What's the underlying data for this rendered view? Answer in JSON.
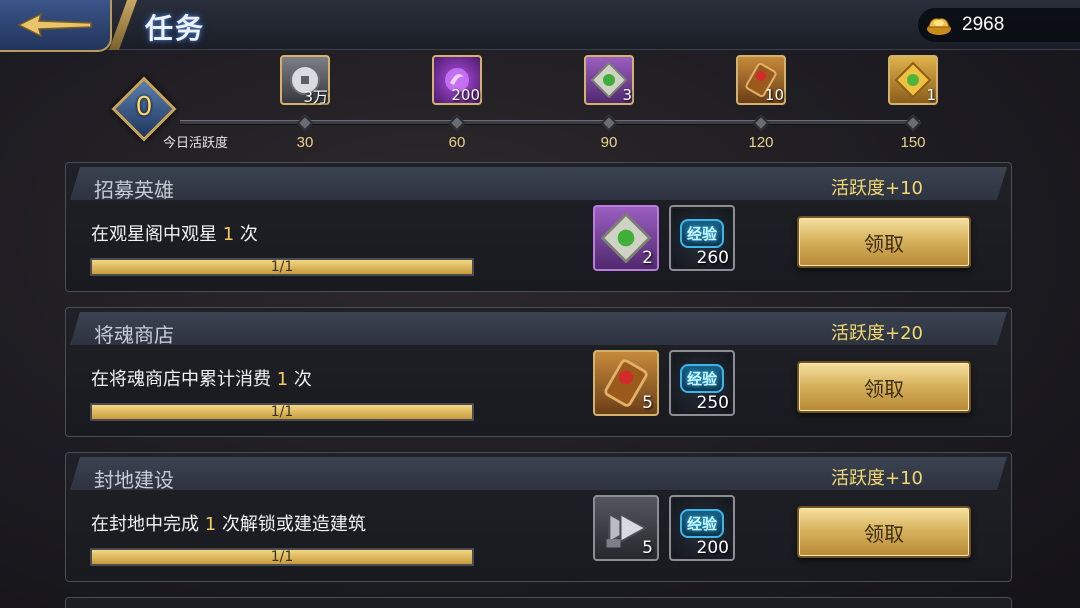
{
  "header": {
    "title": "任务",
    "currency": "2968"
  },
  "activity": {
    "value": "0",
    "label": "今日活跃度",
    "milestones": [
      {
        "threshold": "30",
        "reward_count": "3万",
        "icon": "coin-icon"
      },
      {
        "threshold": "60",
        "reward_count": "200",
        "icon": "purple-orb-icon"
      },
      {
        "threshold": "90",
        "reward_count": "3",
        "icon": "jade-token-icon"
      },
      {
        "threshold": "120",
        "reward_count": "10",
        "icon": "scroll-icon"
      },
      {
        "threshold": "150",
        "reward_count": "1",
        "icon": "gold-token-icon"
      }
    ]
  },
  "tasks": [
    {
      "name": "招募英雄",
      "points": "活跃度+10",
      "desc_pre": "在观星阁中观星 ",
      "desc_num": "1",
      "desc_post": " 次",
      "progress_text": "1/1",
      "progress": 1.0,
      "reward1_count": "2",
      "reward1_icon": "jade-token-icon",
      "exp_label": "经验",
      "exp_value": "260",
      "button": "领取"
    },
    {
      "name": "将魂商店",
      "points": "活跃度+20",
      "desc_pre": "在将魂商店中累计消费 ",
      "desc_num": "1",
      "desc_post": " 次",
      "progress_text": "1/1",
      "progress": 1.0,
      "reward1_count": "5",
      "reward1_icon": "scroll-icon",
      "exp_label": "经验",
      "exp_value": "250",
      "button": "领取"
    },
    {
      "name": "封地建设",
      "points": "活跃度+10",
      "desc_pre": "在封地中完成 ",
      "desc_num": "1",
      "desc_post": " 次解锁或建造建筑",
      "progress_text": "1/1",
      "progress": 1.0,
      "reward1_count": "5",
      "reward1_icon": "hammer-icon",
      "exp_label": "经验",
      "exp_value": "200",
      "button": "领取"
    }
  ]
}
